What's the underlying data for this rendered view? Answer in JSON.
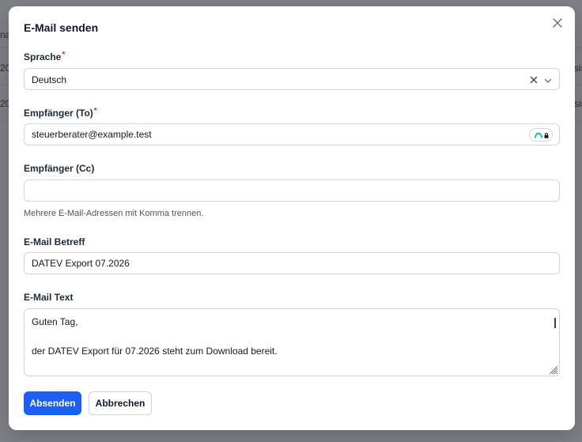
{
  "background": {
    "fragments": [
      {
        "text": "na"
      },
      {
        "text": "20"
      },
      {
        "text": "20"
      },
      {
        "text": "sis"
      },
      {
        "text": "sis"
      }
    ]
  },
  "dialog": {
    "title": "E-Mail senden",
    "language": {
      "label": "Sprache",
      "required_mark": "*",
      "value": "Deutsch"
    },
    "to": {
      "label": "Empfänger (To)",
      "required_mark": "*",
      "value": "steuerberater@example.test"
    },
    "cc": {
      "label": "Empfänger (Cc)",
      "value": "",
      "hint": "Mehrere E-Mail-Adressen mit Komma trennen."
    },
    "subject": {
      "label": "E-Mail Betreff",
      "value": "DATEV Export 07.2026"
    },
    "body": {
      "label": "E-Mail Text",
      "lines": [
        "Guten Tag,",
        "der DATEV Export für 07.2026 steht zum Download bereit."
      ]
    },
    "buttons": {
      "send": "Absenden",
      "cancel": "Abbrechen"
    }
  },
  "colors": {
    "primary": "#1d5ef5",
    "required": "#dc2626",
    "badge_accent": "#22c5a8"
  },
  "icons": {
    "close": "close-icon",
    "clear": "clear-icon",
    "chevron": "chevron-down-icon",
    "password_manager": "password-manager-icon",
    "resize": "resize-handle-icon"
  }
}
